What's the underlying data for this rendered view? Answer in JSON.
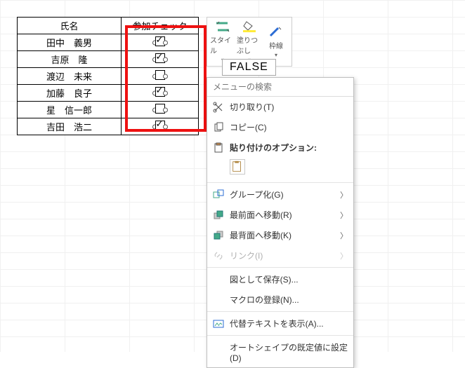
{
  "table": {
    "header_name": "氏名",
    "header_check": "参加チェック",
    "rows": [
      {
        "name": "田中　義男",
        "checked": true
      },
      {
        "name": "吉原　隆",
        "checked": true
      },
      {
        "name": "渡辺　未来",
        "checked": false
      },
      {
        "name": "加藤　良子",
        "checked": true
      },
      {
        "name": "星　信一郎",
        "checked": false
      },
      {
        "name": "吉田　浩二",
        "checked": true
      }
    ]
  },
  "mini_toolbar": {
    "style": "スタイル",
    "fill": "塗りつぶし",
    "outline": "枠線"
  },
  "cell_display": "FALSE",
  "context_menu": {
    "search_placeholder": "メニューの検索",
    "cut": "切り取り(T)",
    "copy": "コピー(C)",
    "paste_header": "貼り付けのオプション:",
    "group": "グループ化(G)",
    "bring_front": "最前面へ移動(R)",
    "send_back": "最背面へ移動(K)",
    "link": "リンク(I)",
    "save_pic": "図として保存(S)...",
    "assign_macro": "マクロの登録(N)...",
    "alt_text": "代替テキストを表示(A)...",
    "default_shape": "オートシェイプの既定値に設定(D)"
  }
}
